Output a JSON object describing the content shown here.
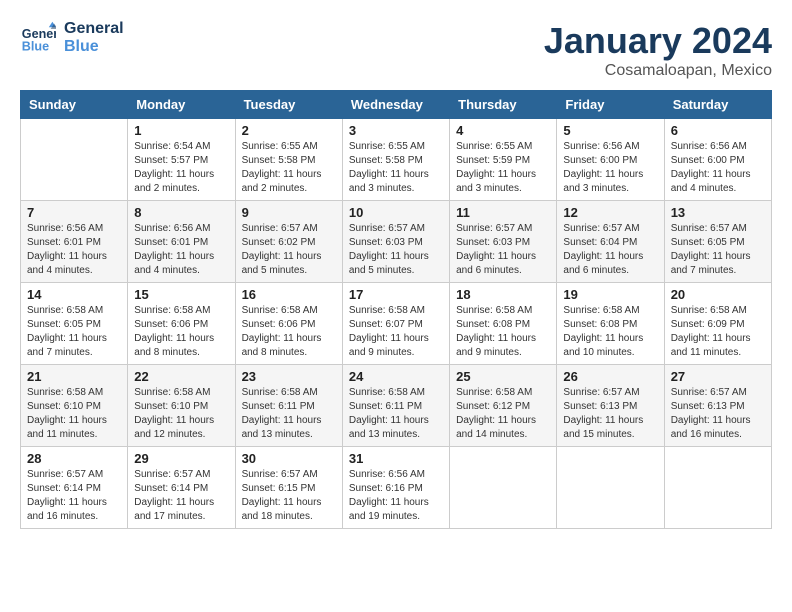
{
  "logo": {
    "line1": "General",
    "line2": "Blue"
  },
  "title": "January 2024",
  "location": "Cosamaloapan, Mexico",
  "weekdays": [
    "Sunday",
    "Monday",
    "Tuesday",
    "Wednesday",
    "Thursday",
    "Friday",
    "Saturday"
  ],
  "weeks": [
    [
      {
        "day": "",
        "info": ""
      },
      {
        "day": "1",
        "info": "Sunrise: 6:54 AM\nSunset: 5:57 PM\nDaylight: 11 hours\nand 2 minutes."
      },
      {
        "day": "2",
        "info": "Sunrise: 6:55 AM\nSunset: 5:58 PM\nDaylight: 11 hours\nand 2 minutes."
      },
      {
        "day": "3",
        "info": "Sunrise: 6:55 AM\nSunset: 5:58 PM\nDaylight: 11 hours\nand 3 minutes."
      },
      {
        "day": "4",
        "info": "Sunrise: 6:55 AM\nSunset: 5:59 PM\nDaylight: 11 hours\nand 3 minutes."
      },
      {
        "day": "5",
        "info": "Sunrise: 6:56 AM\nSunset: 6:00 PM\nDaylight: 11 hours\nand 3 minutes."
      },
      {
        "day": "6",
        "info": "Sunrise: 6:56 AM\nSunset: 6:00 PM\nDaylight: 11 hours\nand 4 minutes."
      }
    ],
    [
      {
        "day": "7",
        "info": "Sunrise: 6:56 AM\nSunset: 6:01 PM\nDaylight: 11 hours\nand 4 minutes."
      },
      {
        "day": "8",
        "info": "Sunrise: 6:56 AM\nSunset: 6:01 PM\nDaylight: 11 hours\nand 4 minutes."
      },
      {
        "day": "9",
        "info": "Sunrise: 6:57 AM\nSunset: 6:02 PM\nDaylight: 11 hours\nand 5 minutes."
      },
      {
        "day": "10",
        "info": "Sunrise: 6:57 AM\nSunset: 6:03 PM\nDaylight: 11 hours\nand 5 minutes."
      },
      {
        "day": "11",
        "info": "Sunrise: 6:57 AM\nSunset: 6:03 PM\nDaylight: 11 hours\nand 6 minutes."
      },
      {
        "day": "12",
        "info": "Sunrise: 6:57 AM\nSunset: 6:04 PM\nDaylight: 11 hours\nand 6 minutes."
      },
      {
        "day": "13",
        "info": "Sunrise: 6:57 AM\nSunset: 6:05 PM\nDaylight: 11 hours\nand 7 minutes."
      }
    ],
    [
      {
        "day": "14",
        "info": "Sunrise: 6:58 AM\nSunset: 6:05 PM\nDaylight: 11 hours\nand 7 minutes."
      },
      {
        "day": "15",
        "info": "Sunrise: 6:58 AM\nSunset: 6:06 PM\nDaylight: 11 hours\nand 8 minutes."
      },
      {
        "day": "16",
        "info": "Sunrise: 6:58 AM\nSunset: 6:06 PM\nDaylight: 11 hours\nand 8 minutes."
      },
      {
        "day": "17",
        "info": "Sunrise: 6:58 AM\nSunset: 6:07 PM\nDaylight: 11 hours\nand 9 minutes."
      },
      {
        "day": "18",
        "info": "Sunrise: 6:58 AM\nSunset: 6:08 PM\nDaylight: 11 hours\nand 9 minutes."
      },
      {
        "day": "19",
        "info": "Sunrise: 6:58 AM\nSunset: 6:08 PM\nDaylight: 11 hours\nand 10 minutes."
      },
      {
        "day": "20",
        "info": "Sunrise: 6:58 AM\nSunset: 6:09 PM\nDaylight: 11 hours\nand 11 minutes."
      }
    ],
    [
      {
        "day": "21",
        "info": "Sunrise: 6:58 AM\nSunset: 6:10 PM\nDaylight: 11 hours\nand 11 minutes."
      },
      {
        "day": "22",
        "info": "Sunrise: 6:58 AM\nSunset: 6:10 PM\nDaylight: 11 hours\nand 12 minutes."
      },
      {
        "day": "23",
        "info": "Sunrise: 6:58 AM\nSunset: 6:11 PM\nDaylight: 11 hours\nand 13 minutes."
      },
      {
        "day": "24",
        "info": "Sunrise: 6:58 AM\nSunset: 6:11 PM\nDaylight: 11 hours\nand 13 minutes."
      },
      {
        "day": "25",
        "info": "Sunrise: 6:58 AM\nSunset: 6:12 PM\nDaylight: 11 hours\nand 14 minutes."
      },
      {
        "day": "26",
        "info": "Sunrise: 6:57 AM\nSunset: 6:13 PM\nDaylight: 11 hours\nand 15 minutes."
      },
      {
        "day": "27",
        "info": "Sunrise: 6:57 AM\nSunset: 6:13 PM\nDaylight: 11 hours\nand 16 minutes."
      }
    ],
    [
      {
        "day": "28",
        "info": "Sunrise: 6:57 AM\nSunset: 6:14 PM\nDaylight: 11 hours\nand 16 minutes."
      },
      {
        "day": "29",
        "info": "Sunrise: 6:57 AM\nSunset: 6:14 PM\nDaylight: 11 hours\nand 17 minutes."
      },
      {
        "day": "30",
        "info": "Sunrise: 6:57 AM\nSunset: 6:15 PM\nDaylight: 11 hours\nand 18 minutes."
      },
      {
        "day": "31",
        "info": "Sunrise: 6:56 AM\nSunset: 6:16 PM\nDaylight: 11 hours\nand 19 minutes."
      },
      {
        "day": "",
        "info": ""
      },
      {
        "day": "",
        "info": ""
      },
      {
        "day": "",
        "info": ""
      }
    ]
  ]
}
